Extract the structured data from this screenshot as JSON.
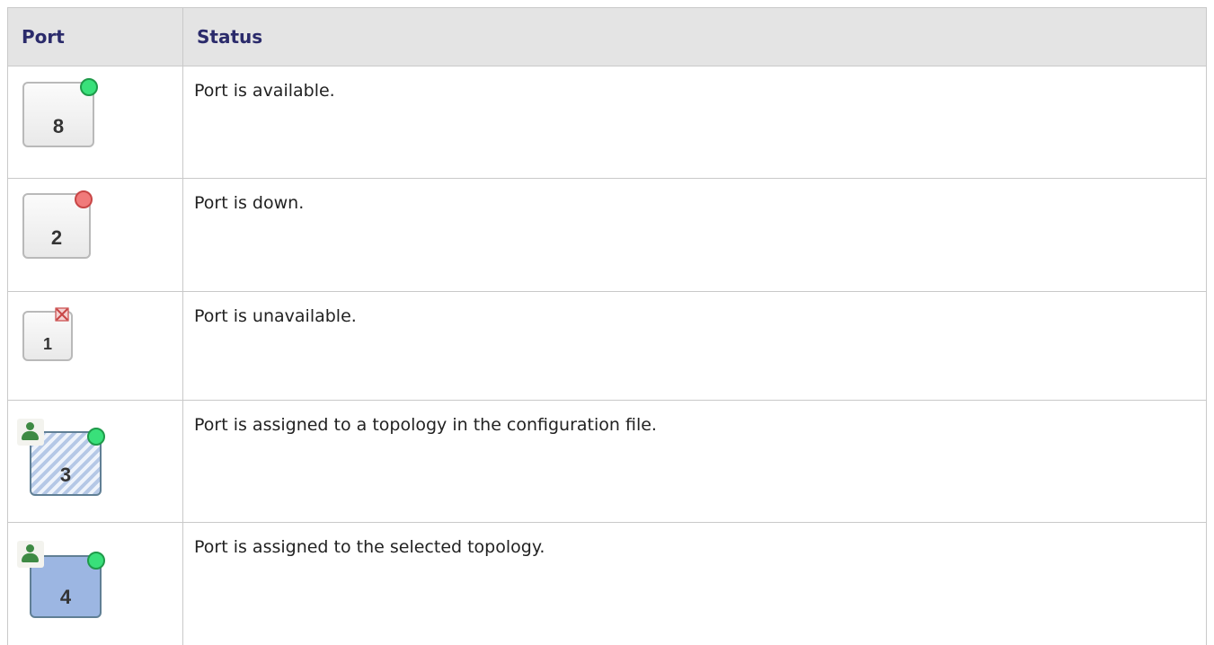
{
  "table": {
    "headers": {
      "port": "Port",
      "status": "Status"
    },
    "rows": [
      {
        "port_number": "8",
        "indicator": "green-dot-icon",
        "status": "Port is available."
      },
      {
        "port_number": "2",
        "indicator": "red-dot-icon",
        "status": "Port is down."
      },
      {
        "port_number": "1",
        "indicator": "red-x-icon",
        "status": "Port is unavailable."
      },
      {
        "port_number": "3",
        "indicator": "user-icon + green-dot-icon (hatched)",
        "status": "Port is assigned to a topology in the configuration file."
      },
      {
        "port_number": "4",
        "indicator": "user-icon + green-dot-icon (filled)",
        "status": "Port is assigned to the selected topology."
      }
    ]
  },
  "colors": {
    "header_text": "#2b2b6b",
    "header_bg": "#e4e4e4",
    "status_green": "#39e07a",
    "status_red": "#f07a7a",
    "assigned_fill": "#9cb6e2"
  }
}
